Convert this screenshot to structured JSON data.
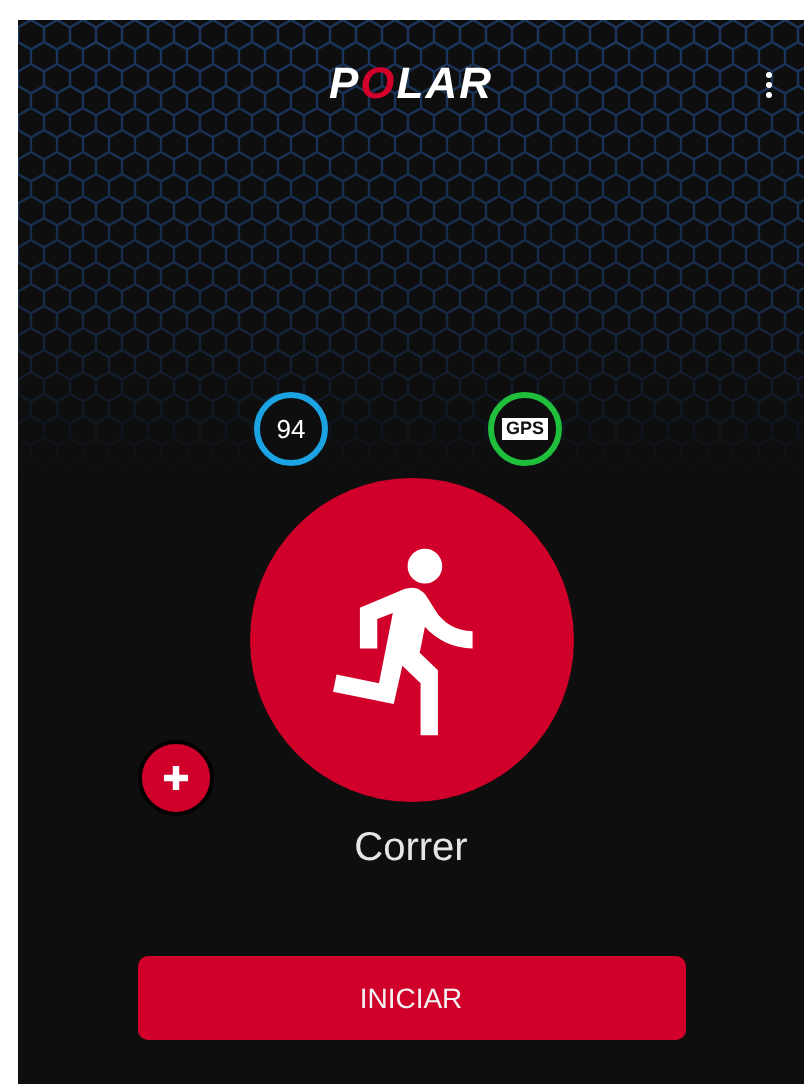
{
  "header": {
    "logo": "POLAR"
  },
  "indicators": [
    {
      "kind": "heart_rate",
      "text": "94",
      "color": "#1ba3e3"
    },
    {
      "kind": "gps",
      "text": "GPS",
      "color": "#1fbf3c"
    }
  ],
  "sport": {
    "name": "Correr"
  },
  "start_button": {
    "label": "INICIAR"
  }
}
